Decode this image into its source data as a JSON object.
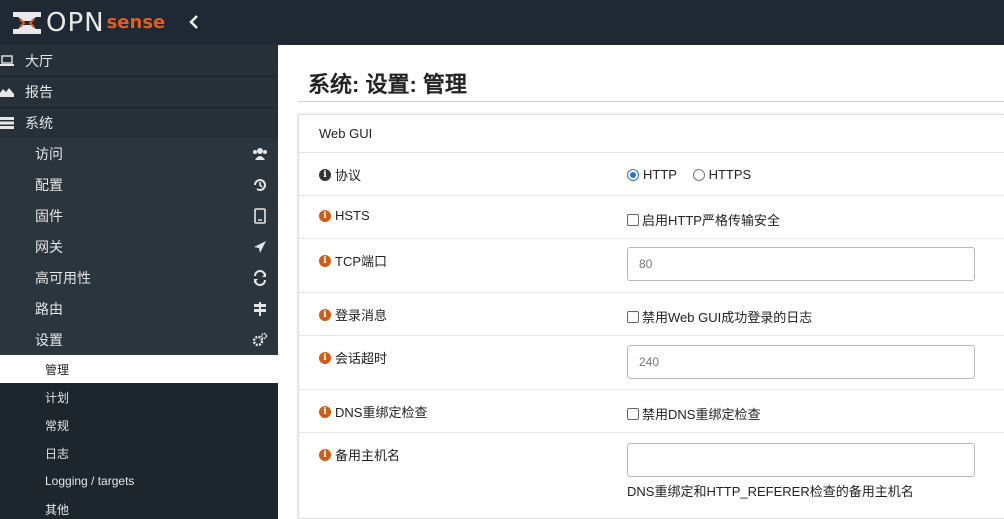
{
  "brand": {
    "name": "OPN",
    "suffix": "sense",
    "accent": "#e55c1f"
  },
  "sidebar": {
    "top_items": [
      {
        "label": "大厅",
        "icon": "laptop-icon"
      },
      {
        "label": "报告",
        "icon": "area-chart-icon"
      },
      {
        "label": "系统",
        "icon": "server-icon"
      }
    ],
    "sub_items": [
      {
        "label": "访问",
        "icon": "users-icon"
      },
      {
        "label": "配置",
        "icon": "history-icon"
      },
      {
        "label": "固件",
        "icon": "tablet-icon"
      },
      {
        "label": "网关",
        "icon": "location-arrow-icon"
      },
      {
        "label": "高可用性",
        "icon": "refresh-icon"
      },
      {
        "label": "路由",
        "icon": "signpost-icon"
      },
      {
        "label": "设置",
        "icon": "cogs-icon"
      }
    ],
    "leaf_items": [
      {
        "label": "管理",
        "active": true
      },
      {
        "label": "计划"
      },
      {
        "label": "常规"
      },
      {
        "label": "日志"
      },
      {
        "label": "Logging / targets"
      },
      {
        "label": "其他"
      }
    ]
  },
  "page": {
    "title": "系统: 设置: 管理"
  },
  "panel": {
    "header": "Web GUI",
    "protocol": {
      "label": "协议",
      "options": [
        "HTTP",
        "HTTPS"
      ],
      "selected": "HTTP"
    },
    "hsts": {
      "label": "HSTS",
      "checkbox_label": "启用HTTP严格传输安全",
      "checked": false
    },
    "tcp_port": {
      "label": "TCP端口",
      "placeholder": "80"
    },
    "login_msg": {
      "label": "登录消息",
      "checkbox_label": "禁用Web GUI成功登录的日志",
      "checked": false
    },
    "session_timeout": {
      "label": "会话超时",
      "placeholder": "240"
    },
    "dns_rebind": {
      "label": "DNS重绑定检查",
      "checkbox_label": "禁用DNS重绑定检查",
      "checked": false
    },
    "alt_hostnames": {
      "label": "备用主机名",
      "value": "",
      "help": "DNS重绑定和HTTP_REFERER检查的备用主机名"
    }
  }
}
